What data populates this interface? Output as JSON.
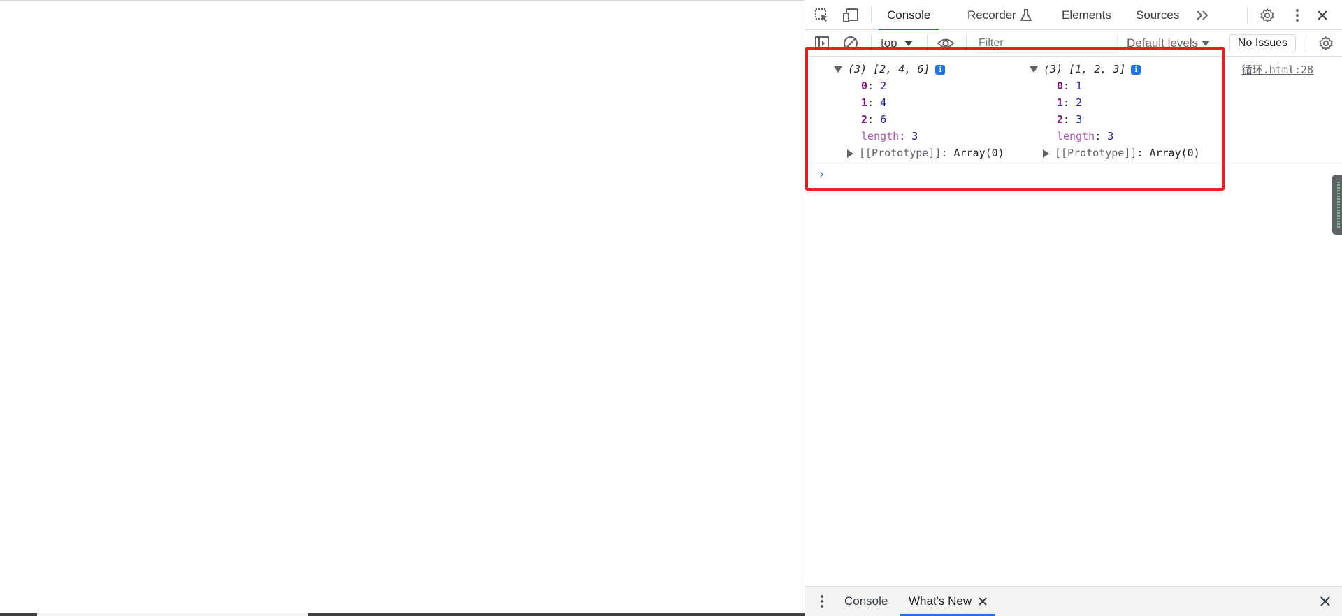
{
  "devtools": {
    "tabs": [
      "Console",
      "Recorder",
      "Elements",
      "Sources"
    ],
    "active_tab": "Console",
    "icons": [
      "inspect-element-icon",
      "device-toolbar-icon",
      "flask-icon",
      "more-tabs-icon",
      "settings-icon",
      "more-options-icon",
      "close-icon"
    ]
  },
  "toolbar": {
    "context": "top",
    "filter_placeholder": "Filter",
    "levels": "Default levels",
    "issues": "No Issues"
  },
  "console": {
    "source_link": "循环.html:28",
    "arrays": [
      {
        "summary": "(3) [2, 4, 6]",
        "entries": [
          {
            "key": "0",
            "value": "2"
          },
          {
            "key": "1",
            "value": "4"
          },
          {
            "key": "2",
            "value": "6"
          }
        ],
        "length_key": "length",
        "length_value": "3",
        "prototype_key": "[[Prototype]]",
        "prototype_value": "Array(0)"
      },
      {
        "summary": "(3) [1, 2, 3]",
        "entries": [
          {
            "key": "0",
            "value": "1"
          },
          {
            "key": "1",
            "value": "2"
          },
          {
            "key": "2",
            "value": "3"
          }
        ],
        "length_key": "length",
        "length_value": "3",
        "prototype_key": "[[Prototype]]",
        "prototype_value": "Array(0)"
      }
    ],
    "prompt": "›",
    "info_badge": "i"
  },
  "drawer": {
    "tabs": [
      "Console",
      "What's New"
    ],
    "active_tab": "What's New"
  },
  "colors": {
    "accent": "#1a73e8",
    "highlight_box": "#ee1c1c",
    "key_color": "#881280",
    "number_color": "#1a1aa6"
  }
}
